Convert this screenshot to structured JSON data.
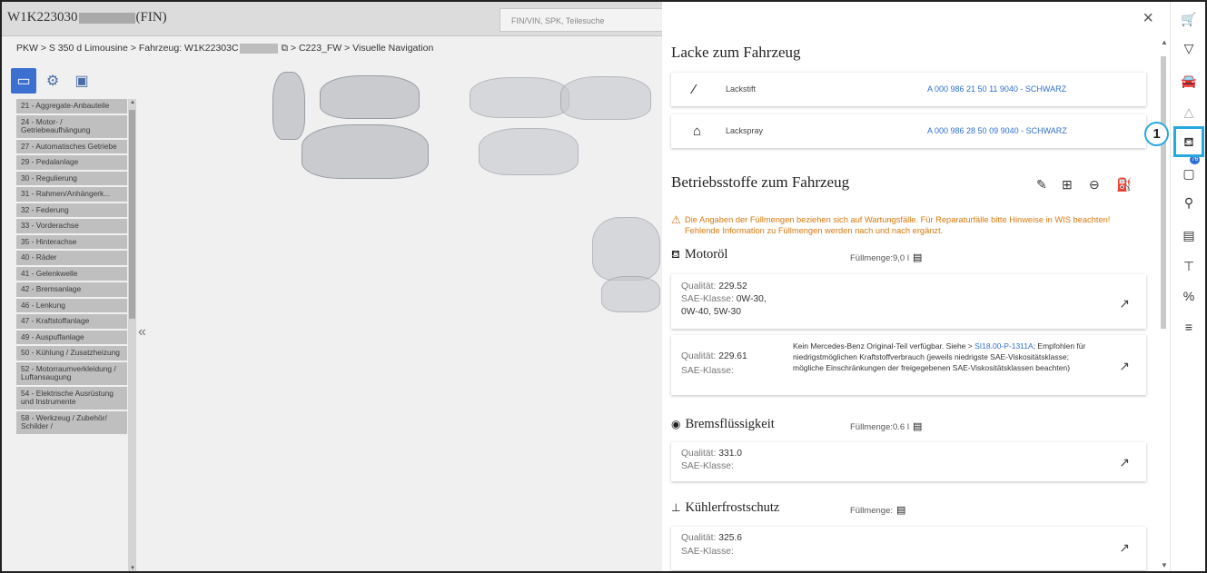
{
  "header": {
    "vin_prefix": "W1K223030",
    "vin_suffix": "(FIN)",
    "search_placeholder": "FIN/VIN, SPK, Teilesuche"
  },
  "breadcrumb": {
    "part1": "PKW > S 350 d Limousine > Fahrzeug: W1K22303C",
    "part2": "> C223_FW  > Visuelle Navigation"
  },
  "menu_items": [
    "21 - Aggregate-Anbauteile",
    "24 - Motor- / Getriebeaufhängung",
    "27 - Automatisches Getriebe",
    "29 - Pedalanlage",
    "30 - Regulierung",
    "31 - Rahmen/Anhängerk...",
    "32 - Federung",
    "33 - Vorderachse",
    "35 - Hinterachse",
    "40 - Räder",
    "41 - Gelenkwelle",
    "42 - Bremsanlage",
    "46 - Lenkung",
    "47 - Kraftstoffanlage",
    "49 - Auspuffanlage",
    "50 - Kühlung / Zusatzheizung",
    "52 - Motorraumverkleidung / Luftansaugung",
    "54 - Elektrische Ausrüstung und Instrumente",
    "58 - Werkzeug / Zubehör/ Schilder /"
  ],
  "collapse_glyph": "«",
  "panel": {
    "close_glyph": "×",
    "lacke_title": "Lacke zum Fahrzeug",
    "lacke": [
      {
        "icon": "pen-icon",
        "glyph": "⁄",
        "name": "Lackstift",
        "part": "A 000 986 21 50 11 9040 - SCHWARZ"
      },
      {
        "icon": "spray-can-icon",
        "glyph": "⌂",
        "name": "Lackspray",
        "part": "A 000 986 28 50 09 9040 - SCHWARZ"
      }
    ],
    "betrieb_title": "Betriebsstoffe zum Fahrzeug",
    "warning": "Die Angaben der Füllmengen beziehen sich auf Wartungsfälle. Für Reparaturfälle bitte Hinweise in WIS beachten! Fehlende Information zu Füllmengen werden nach und nach ergänzt.",
    "motoroel": {
      "title": "Motoröl",
      "fill_label": "Füllmenge:",
      "fill_value": "9,0 l",
      "cards": [
        {
          "q_label": "Qualität:",
          "q_value": "229.52",
          "sae_label": "SAE-Klasse:",
          "sae_value": "0W-30,",
          "sae_value2": "0W-40, 5W-30"
        },
        {
          "q_label": "Qualität:",
          "q_value": "229.61",
          "sae_label": "SAE-Klasse:",
          "note_pre": "Kein Mercedes-Benz Original-Teil verfügbar. Siehe > ",
          "note_link": "SI18.00-P-1311A",
          "note_post": "; Empfohlen für niedrigstmöglichen Kraftstoffverbrauch (jeweils niedrigste SAE-Viskositätsklasse; mögliche Einschränkungen der freigegebenen SAE-Viskositätsklassen beachten)"
        }
      ]
    },
    "brems": {
      "title": "Bremsflüssigkeit",
      "fill_label": "Füllmenge:",
      "fill_value": "0.6 l",
      "q_label": "Qualität:",
      "q_value": "331.0",
      "sae_label": "SAE-Klasse:"
    },
    "kuehler": {
      "title": "Kühlerfrostschutz",
      "fill_label": "Füllmenge:",
      "q_label": "Qualität:",
      "q_value": "325.6",
      "sae_label": "SAE-Klasse:"
    }
  },
  "right_toolbar": {
    "badge": "76",
    "highlight_number": "1"
  }
}
